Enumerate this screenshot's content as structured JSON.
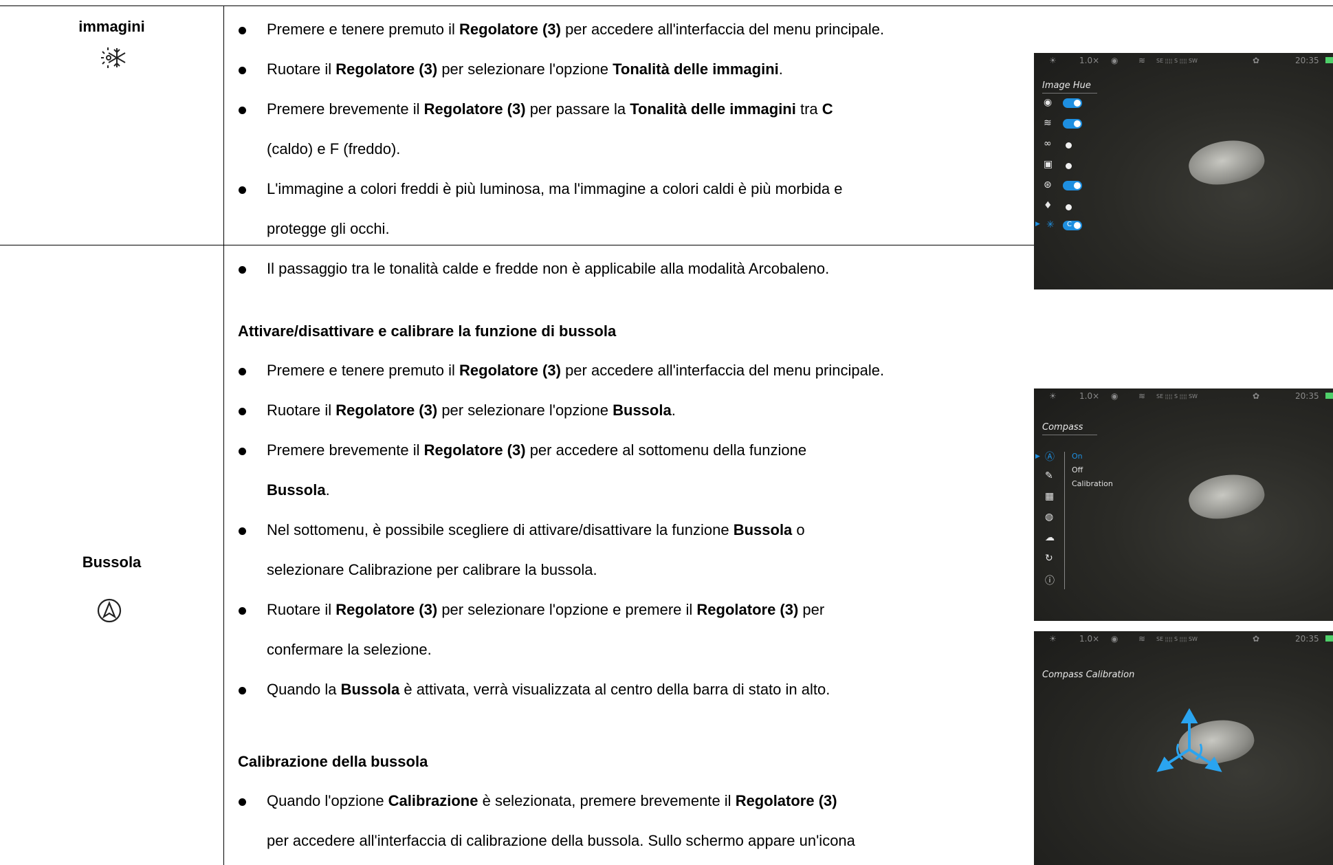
{
  "row1": {
    "label": "immagini",
    "icon": "snowflake-sun-icon",
    "bullets": [
      [
        {
          "t": "Premere e tenere premuto il "
        },
        {
          "t": "Regolatore (3)",
          "b": true
        },
        {
          "t": " per accedere all'interfaccia del menu principale."
        }
      ],
      [
        {
          "t": "Ruotare il "
        },
        {
          "t": "Regolatore (3)",
          "b": true
        },
        {
          "t": " per selezionare l'opzione "
        },
        {
          "t": "Tonalità delle immagini",
          "b": true
        },
        {
          "t": "."
        }
      ],
      [
        {
          "t": "Premere brevemente il "
        },
        {
          "t": "Regolatore (3)",
          "b": true
        },
        {
          "t": " per passare la "
        },
        {
          "t": "Tonalità delle immagini",
          "b": true
        },
        {
          "t": " tra "
        },
        {
          "t": "C",
          "b": true
        }
      ],
      [
        {
          "t": "(caldo) e F (freddo)."
        }
      ],
      [
        {
          "t": "L'immagine a colori freddi è più luminosa, ma l'immagine a colori caldi è più morbida e"
        }
      ],
      [
        {
          "t": "protegge gli occhi."
        }
      ],
      [
        {
          "t": "Il passaggio tra le tonalità calde e fredde non è applicabile alla modalità Arcobaleno."
        }
      ]
    ],
    "screenshot": {
      "status": [
        "1.0×",
        "20:35"
      ],
      "compass_strip": "SE ¦¦¦¦ S ¦¦¦¦ SW",
      "title": "Image Hue",
      "toggle_label": "C"
    }
  },
  "row2": {
    "label": "Bussola",
    "icon": "compass-icon",
    "heading1": "Attivare/disattivare e calibrare la funzione di bussola",
    "bullets_a": [
      [
        {
          "t": "Premere e tenere premuto il "
        },
        {
          "t": "Regolatore (3)",
          "b": true
        },
        {
          "t": " per accedere all'interfaccia del menu principale."
        }
      ],
      [
        {
          "t": "Ruotare il "
        },
        {
          "t": "Regolatore (3)",
          "b": true
        },
        {
          "t": " per selezionare l'opzione "
        },
        {
          "t": "Bussola",
          "b": true
        },
        {
          "t": "."
        }
      ],
      [
        {
          "t": "Premere brevemente il "
        },
        {
          "t": "Regolatore (3)",
          "b": true
        },
        {
          "t": " per accedere al sottomenu della funzione"
        }
      ],
      [
        {
          "t": "Bussola",
          "b": true
        },
        {
          "t": "."
        }
      ],
      [
        {
          "t": "Nel sottomenu, è possibile scegliere di attivare/disattivare la funzione "
        },
        {
          "t": "Bussola",
          "b": true
        },
        {
          "t": " o"
        }
      ],
      [
        {
          "t": "selezionare Calibrazione per calibrare la bussola."
        }
      ],
      [
        {
          "t": "Ruotare il "
        },
        {
          "t": "Regolatore (3)",
          "b": true
        },
        {
          "t": " per selezionare l'opzione e premere il "
        },
        {
          "t": "Regolatore (3)",
          "b": true
        },
        {
          "t": " per"
        }
      ],
      [
        {
          "t": "confermare la selezione."
        }
      ],
      [
        {
          "t": "Quando la "
        },
        {
          "t": "Bussola",
          "b": true
        },
        {
          "t": " è attivata, verrà visualizzata al centro della barra di stato in alto."
        }
      ]
    ],
    "heading2": "Calibrazione della bussola",
    "bullets_b": [
      [
        {
          "t": "Quando l'opzione "
        },
        {
          "t": "Calibrazione",
          "b": true
        },
        {
          "t": " è selezionata, premere brevemente il "
        },
        {
          "t": "Regolatore (3)",
          "b": true
        }
      ],
      [
        {
          "t": "per accedere all'interfaccia di calibrazione della bussola. Sullo schermo appare un'icona"
        }
      ]
    ],
    "screenshot_menu": {
      "status": [
        "1.0×",
        "20:35"
      ],
      "compass_strip": "SE ¦¦¦¦ S ¦¦¦¦ SW",
      "title": "Compass",
      "options": [
        "On",
        "Off",
        "Calibration"
      ]
    },
    "screenshot_cal": {
      "status": [
        "1.0×",
        "20:35"
      ],
      "compass_strip": "SE ¦¦¦¦ S ¦¦¦¦ SW",
      "title": "Compass Calibration"
    }
  }
}
